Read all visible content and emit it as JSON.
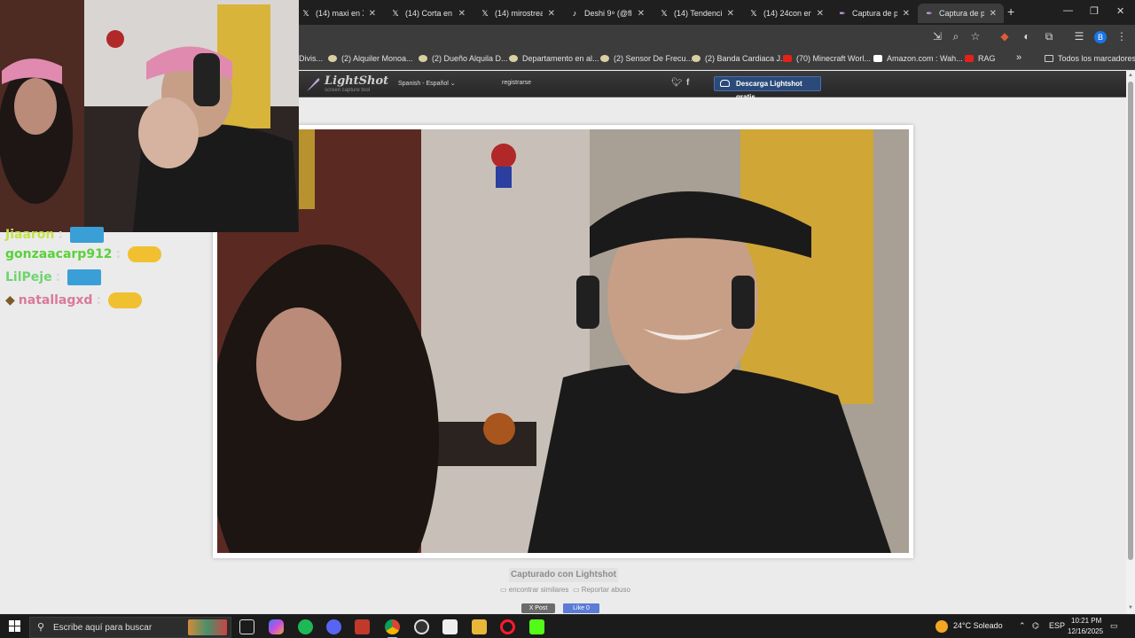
{
  "browser": {
    "tabs": [
      {
        "label": "(14) maxi en X",
        "icon": "x-logo-icon",
        "active": false
      },
      {
        "label": "(14) Corta en X",
        "icon": "x-logo-icon",
        "active": false
      },
      {
        "label": "(14) mirostrea",
        "icon": "x-logo-icon",
        "active": false
      },
      {
        "label": "Deshi 9⁹ (@flo",
        "icon": "tiktok-icon",
        "active": false
      },
      {
        "label": "(14) Tendencia",
        "icon": "x-logo-icon",
        "active": false
      },
      {
        "label": "(14) 24con en",
        "icon": "x-logo-icon",
        "active": false
      },
      {
        "label": "Captura de pa",
        "icon": "lightshot-icon",
        "active": false
      },
      {
        "label": "Captura de pa",
        "icon": "lightshot-icon",
        "active": true
      }
    ],
    "new_tab": "+",
    "profile_initial": "B",
    "bookmarks": [
      {
        "label": "Divis...",
        "icon": "bookmark-icon"
      },
      {
        "label": "(2) Alquiler Monoa...",
        "icon": "bookmark-icon"
      },
      {
        "label": "(2) Dueño Alquila D...",
        "icon": "bookmark-icon"
      },
      {
        "label": "Departamento en al...",
        "icon": "bookmark-icon"
      },
      {
        "label": "(2) Sensor De Frecu...",
        "icon": "bookmark-icon"
      },
      {
        "label": "(2) Banda Cardiaca J...",
        "icon": "bookmark-icon"
      },
      {
        "label": "(70) Minecraft Worl...",
        "icon": "youtube-icon"
      },
      {
        "label": "Amazon.com : Wah...",
        "icon": "amazon-icon"
      },
      {
        "label": "RAG",
        "icon": "youtube-icon"
      }
    ],
    "bookmarks_more": "»",
    "all_bookmarks": "Todos los marcadores"
  },
  "lightshot": {
    "logo": "LightShot",
    "logo_sub": "screen capture tool",
    "language": "Spanish - Español",
    "language_caret": "⌄",
    "register": "registrarse",
    "download": "Descarga Lightshot gratis",
    "captured_with": "Capturado con Lightshot",
    "find_similar": "encontrar similares",
    "report": "Reportar abuso",
    "x_post": "X Post",
    "fb_like": "Like 0"
  },
  "chat": [
    {
      "user": "Jiaaron",
      "color": "#c4e24a"
    },
    {
      "user": "gonzaacarp912",
      "color": "#5ad13a"
    },
    {
      "user": "LilPeje",
      "color": "#6fd36f"
    },
    {
      "user": "natallagxd",
      "color": "#d97a9a"
    }
  ],
  "chat_sep": ":",
  "taskbar": {
    "search_placeholder": "Escribe aquí para buscar",
    "weather": "24°C  Soleado",
    "language": "ESP",
    "time": "10:21 PM",
    "date": "12/16/2025"
  }
}
